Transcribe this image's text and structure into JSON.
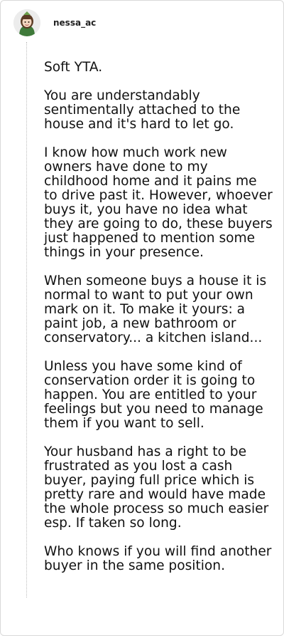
{
  "comment": {
    "username": "nessa_ac",
    "paragraphs": [
      "Soft YTA.",
      "You are understandably sentimentally attached to the house and it's hard to let go.",
      "I know how much work new owners have done to my childhood home and it pains me to drive past it. However, whoever buys it, you have no idea what they are going to do, these buyers just happened to mention some things in your presence.",
      "When someone buys a house it is normal to want to put your own mark on it. To make it yours: a paint job, a new bathroom or conservatory... a kitchen island...",
      "Unless you have some kind of conservation order it is going to happen. You are entitled to your feelings but you need to manage them if you want to sell.",
      "Your husband has a right to be frustrated as you lost a cash buyer, paying full price which is pretty rare and would have made the whole process so much easier esp. If taken so long.",
      "Who knows if you will find another buyer in the same position."
    ]
  }
}
